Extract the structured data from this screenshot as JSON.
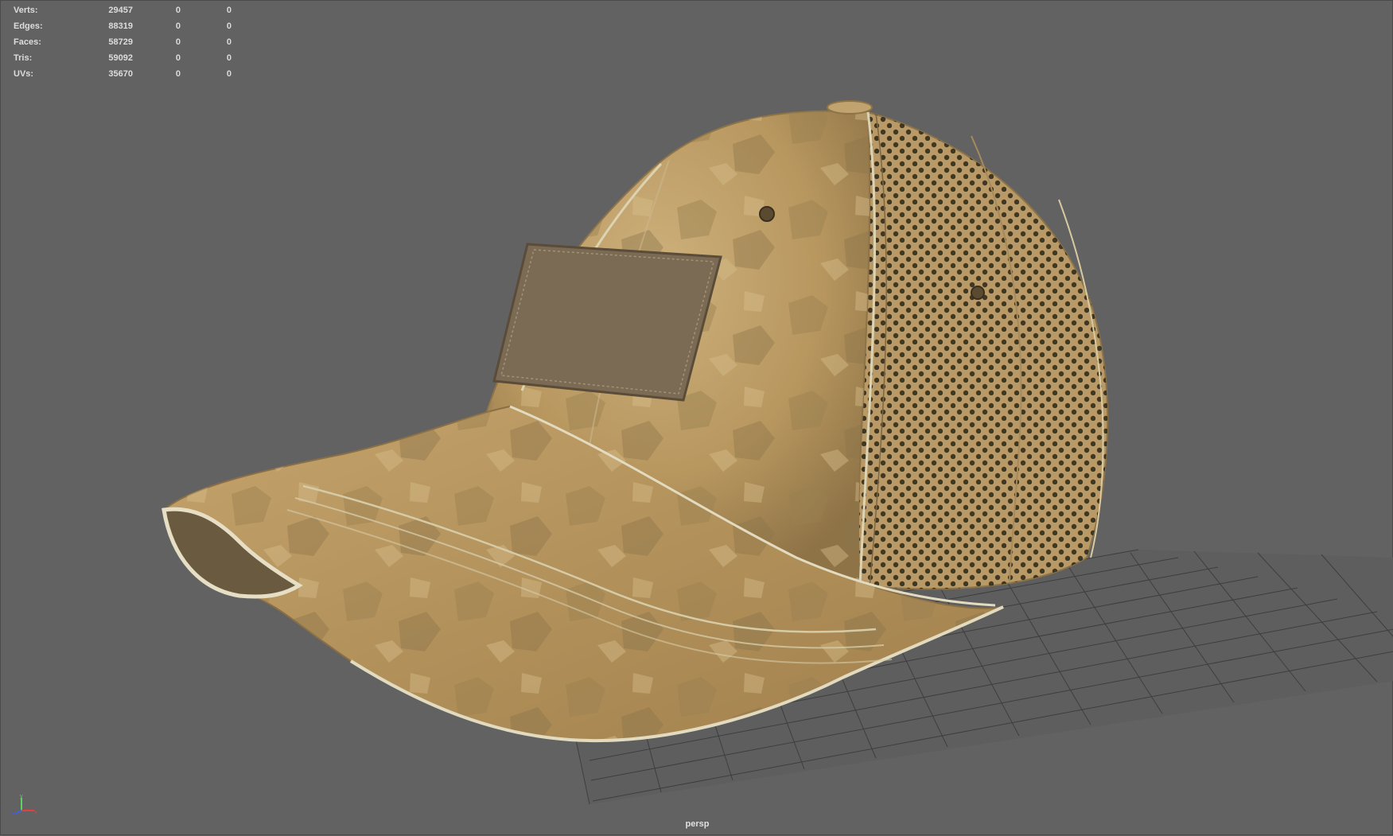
{
  "viewport": {
    "camera": "persp",
    "background_color": "#626262",
    "grid_color": "#3c3c3c"
  },
  "heads_up_display": {
    "rows": [
      {
        "label": "Verts:",
        "value": "29457",
        "selected": "0",
        "component": "0"
      },
      {
        "label": "Edges:",
        "value": "88319",
        "selected": "0",
        "component": "0"
      },
      {
        "label": "Faces:",
        "value": "58729",
        "selected": "0",
        "component": "0"
      },
      {
        "label": "Tris:",
        "value": "59092",
        "selected": "0",
        "component": "0"
      },
      {
        "label": "UVs:",
        "value": "35670",
        "selected": "0",
        "component": "0"
      }
    ]
  },
  "model": {
    "name": "baseball-cap",
    "colors": {
      "fabric_light": "#c8a774",
      "fabric_mid": "#b08d59",
      "fabric_dark": "#8a7149",
      "patch": "#7a6a54",
      "stitch": "#ddd6b8"
    }
  },
  "axis_gizmo": {
    "x_color": "#e04040",
    "y_color": "#60d060",
    "z_color": "#4060e0"
  }
}
